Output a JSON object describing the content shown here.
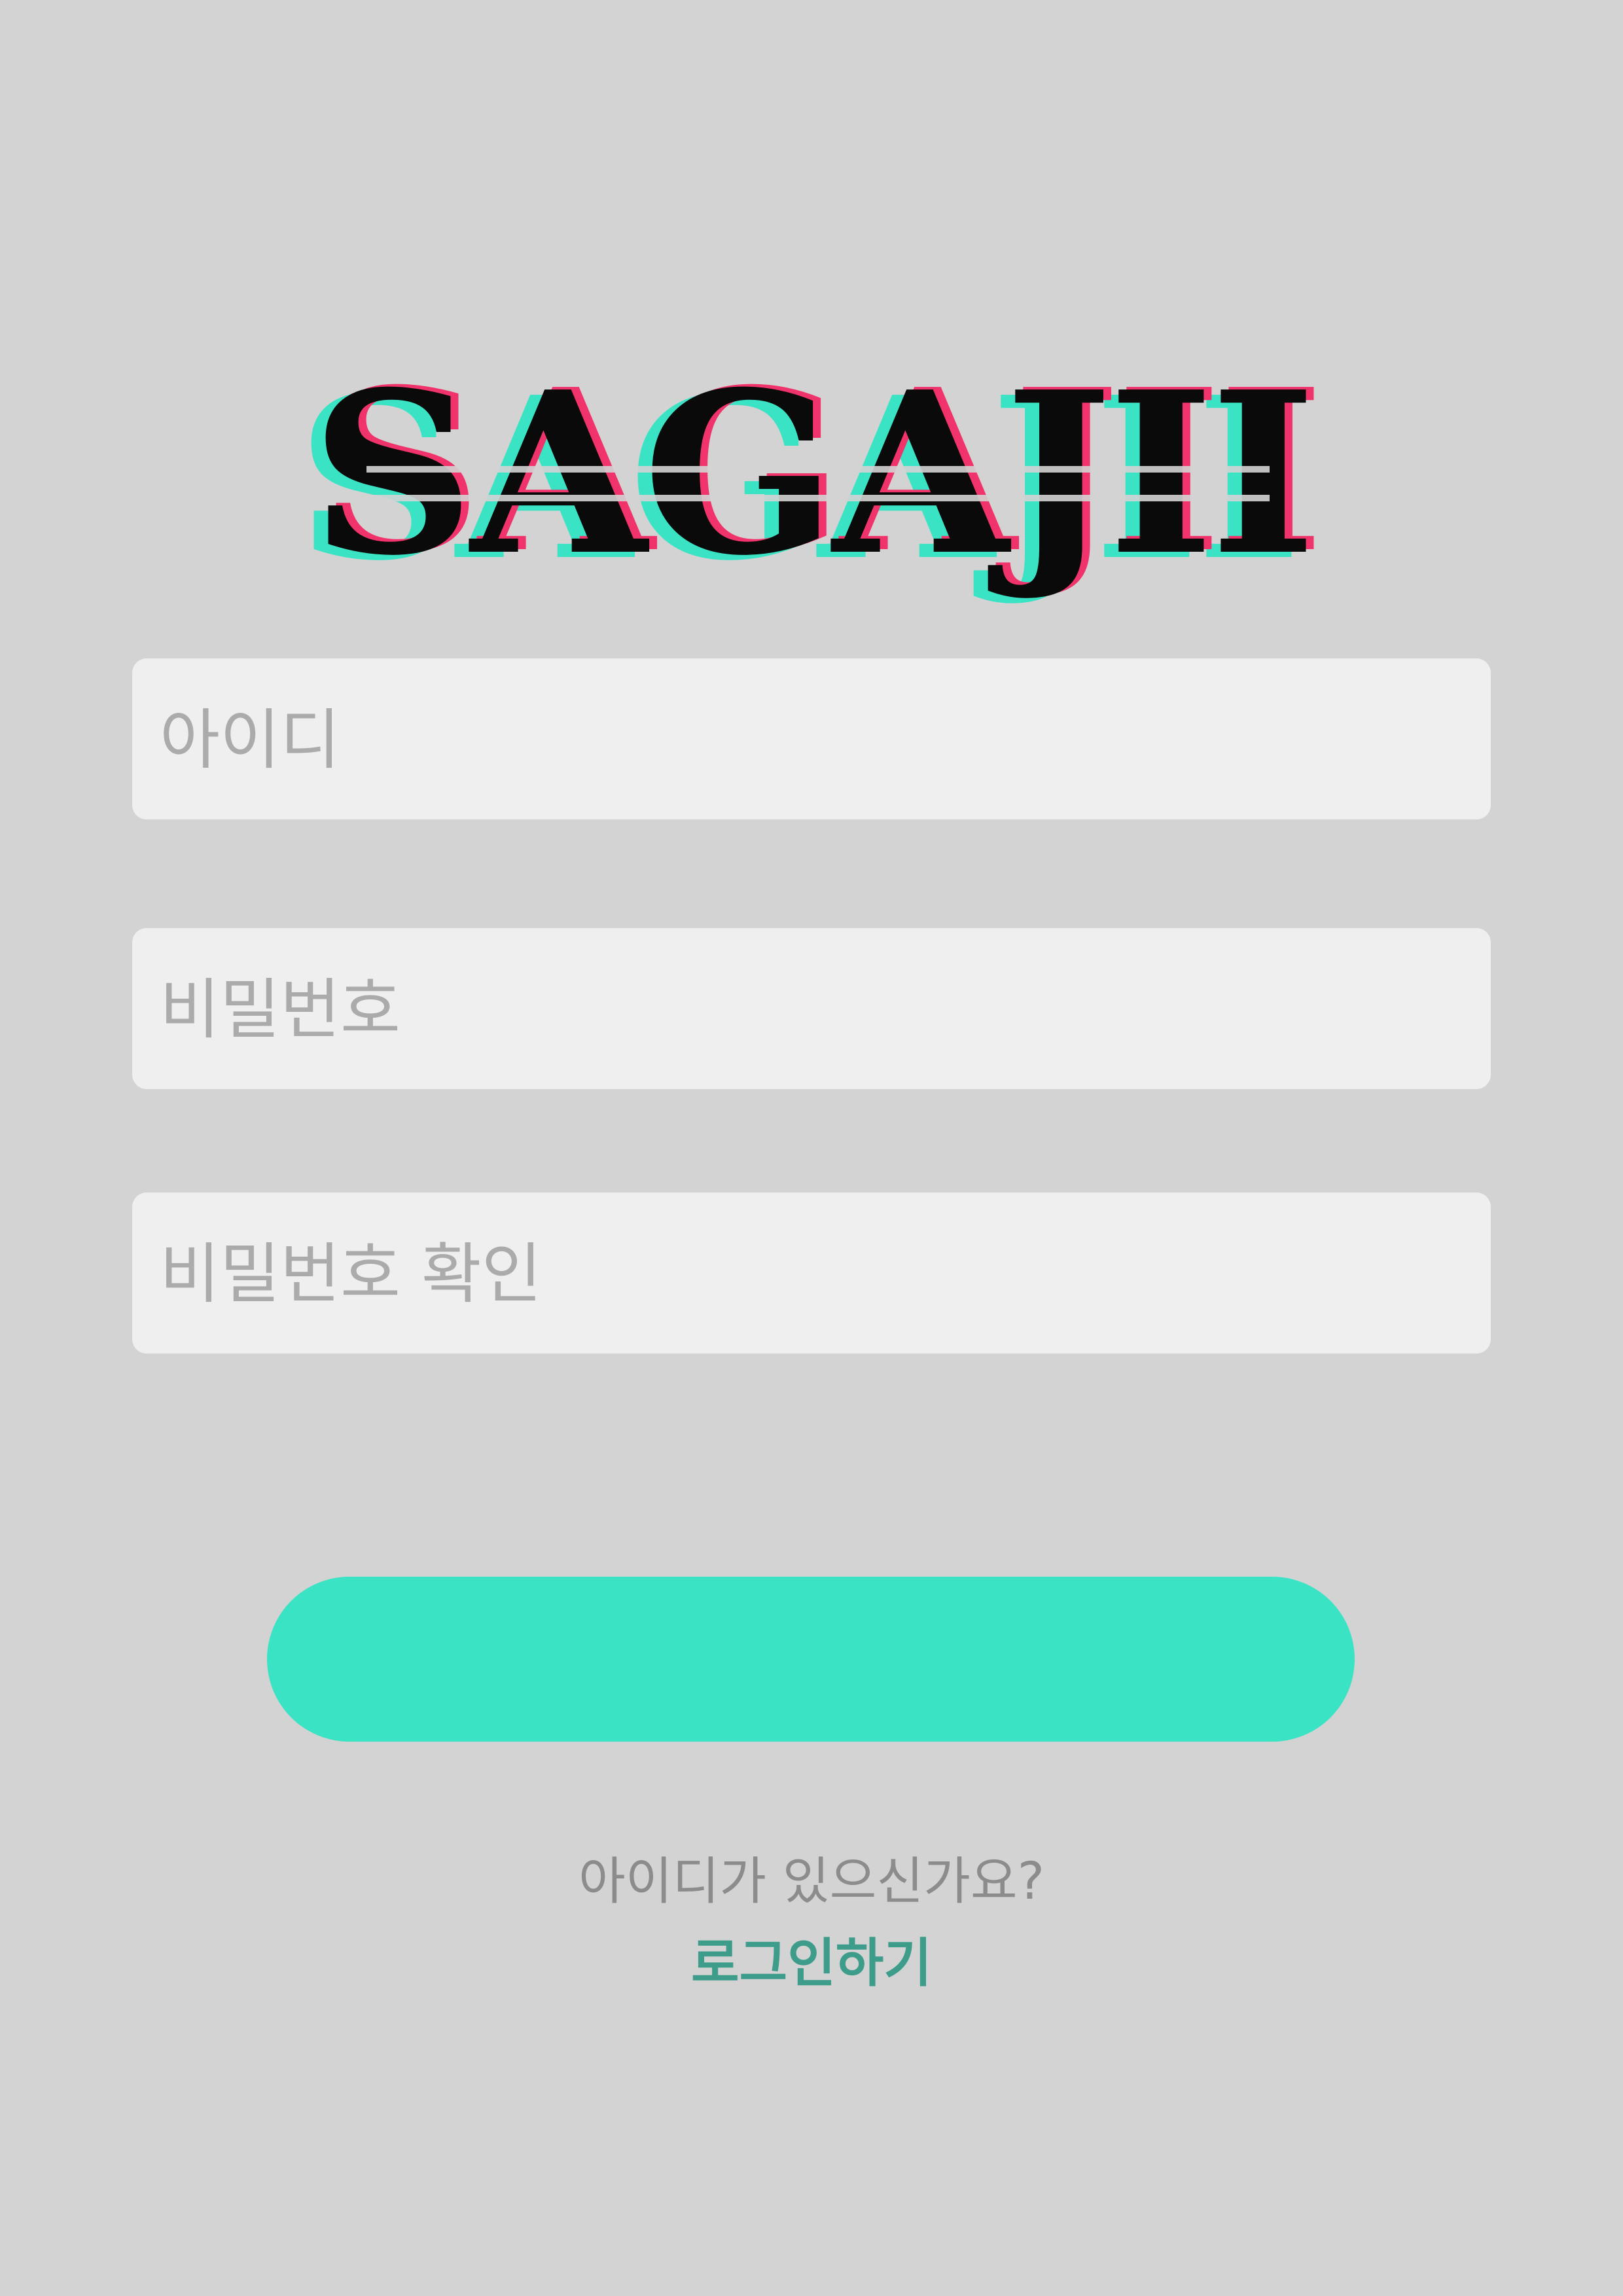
{
  "brand": {
    "logo_text": "SAGAJII"
  },
  "form": {
    "id_placeholder": "아이디",
    "password_placeholder": "비밀번호",
    "password_confirm_placeholder": "비밀번호 확인",
    "submit_label": ""
  },
  "footer": {
    "question": "아이디가 있으신가요?",
    "login_link": "로그인하기"
  },
  "colors": {
    "background": "#d3d3d3",
    "accent": "#3be3c5",
    "link": "#3d9c8a",
    "logo_shadow_pink": "#f0336b",
    "field_background": "#efefef"
  }
}
